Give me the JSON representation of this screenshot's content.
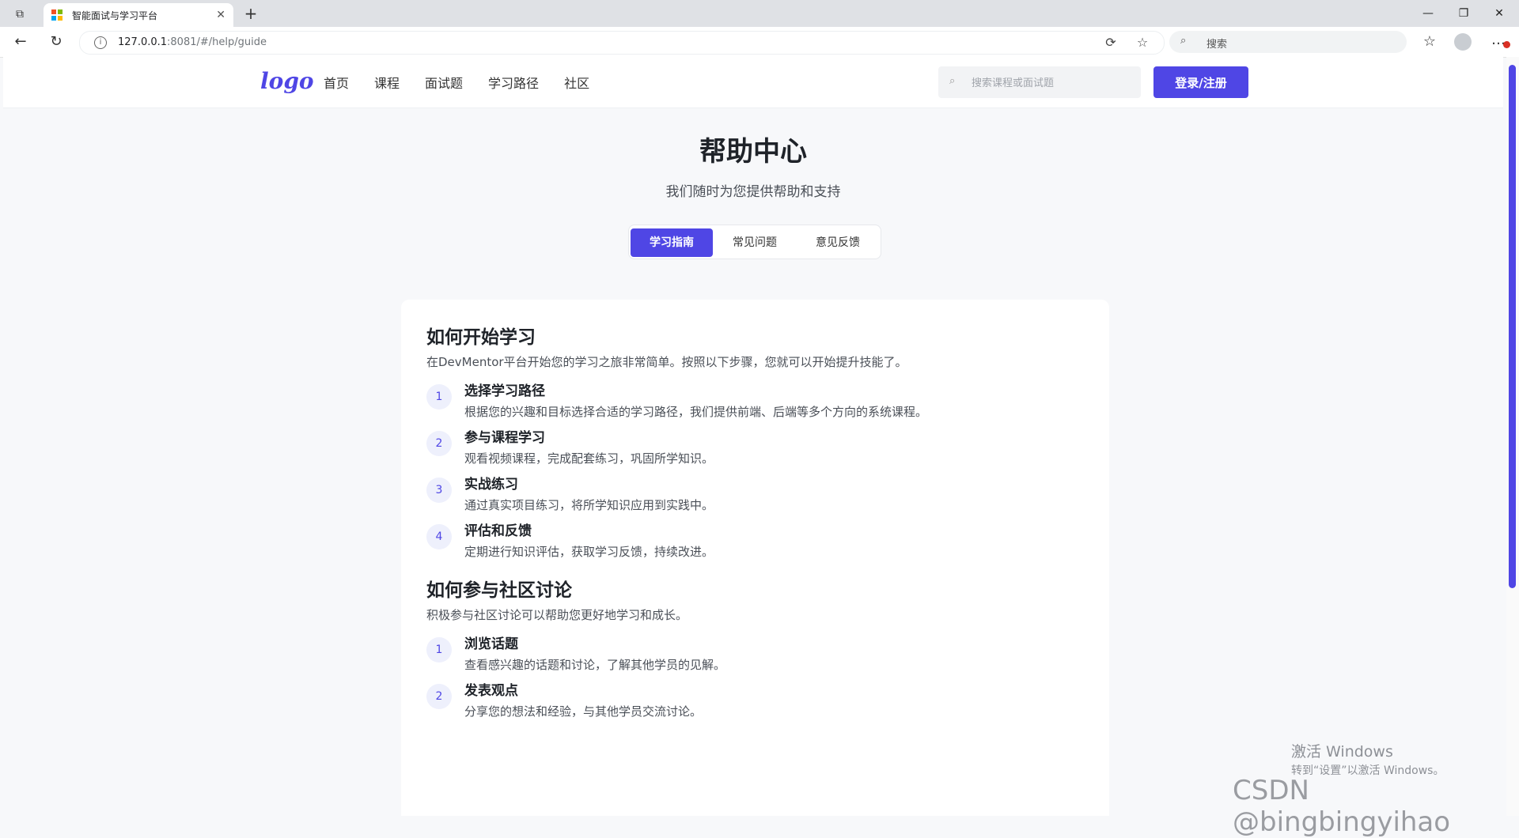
{
  "browser": {
    "tab_title": "智能面试与学习平台",
    "tab_close": "✕",
    "new_tab": "+",
    "url_host": "127.0.0.1",
    "url_rest": ":8081/#/help/guide",
    "search_placeholder": "搜索",
    "window_controls": [
      "—",
      "❐",
      "✕"
    ]
  },
  "header": {
    "logo": "logo",
    "nav": [
      "首页",
      "课程",
      "面试题",
      "学习路径",
      "社区"
    ],
    "search_placeholder": "搜索课程或面试题",
    "login_label": "登录/注册"
  },
  "hero": {
    "title": "帮助中心",
    "subtitle": "我们随时为您提供帮助和支持"
  },
  "tabs": [
    {
      "label": "学习指南",
      "active": true
    },
    {
      "label": "常见问题",
      "active": false
    },
    {
      "label": "意见反馈",
      "active": false
    }
  ],
  "sections": [
    {
      "title": "如何开始学习",
      "intro": "在DevMentor平台开始您的学习之旅非常简单。按照以下步骤，您就可以开始提升技能了。",
      "steps": [
        {
          "num": "1",
          "title": "选择学习路径",
          "desc": "根据您的兴趣和目标选择合适的学习路径，我们提供前端、后端等多个方向的系统课程。"
        },
        {
          "num": "2",
          "title": "参与课程学习",
          "desc": "观看视频课程，完成配套练习，巩固所学知识。"
        },
        {
          "num": "3",
          "title": "实战练习",
          "desc": "通过真实项目练习，将所学知识应用到实践中。"
        },
        {
          "num": "4",
          "title": "评估和反馈",
          "desc": "定期进行知识评估，获取学习反馈，持续改进。"
        }
      ]
    },
    {
      "title": "如何参与社区讨论",
      "intro": "积极参与社区讨论可以帮助您更好地学习和成长。",
      "steps": [
        {
          "num": "1",
          "title": "浏览话题",
          "desc": "查看感兴趣的话题和讨论，了解其他学员的见解。"
        },
        {
          "num": "2",
          "title": "发表观点",
          "desc": "分享您的想法和经验，与其他学员交流讨论。"
        }
      ]
    }
  ],
  "overlay": {
    "win_activate": "激活 Windows",
    "win_activate_sub": "转到“设置”以激活 Windows。",
    "csdn": "CSDN @bingbingyihao"
  },
  "colors": {
    "accent": "#4f46e5",
    "page_bg": "#f7f8fa"
  }
}
